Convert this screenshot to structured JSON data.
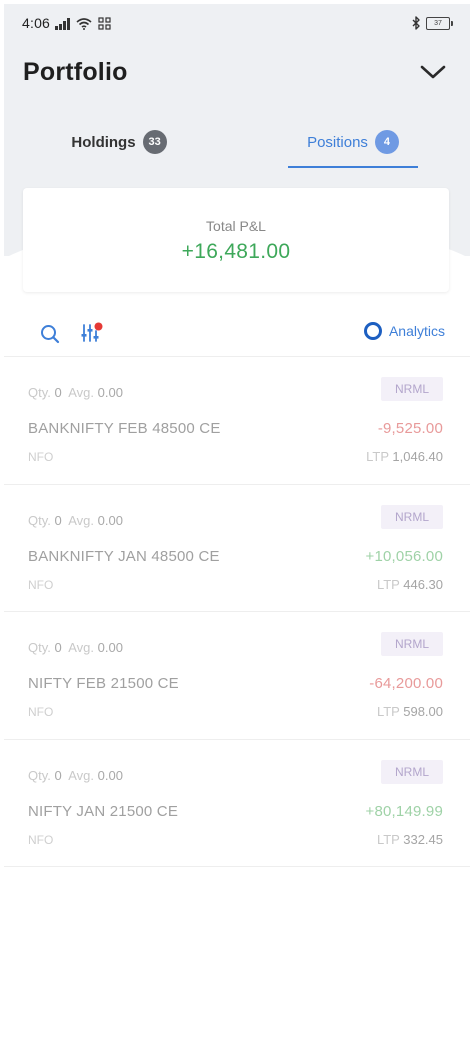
{
  "status_bar": {
    "time": "4:06",
    "battery": "37"
  },
  "header": {
    "title": "Portfolio"
  },
  "tabs": [
    {
      "label": "Holdings",
      "count": "33",
      "active": false
    },
    {
      "label": "Positions",
      "count": "4",
      "active": true
    }
  ],
  "summary": {
    "label": "Total P&L",
    "value": "+16,481.00"
  },
  "toolbar": {
    "analytics_label": "Analytics"
  },
  "colors": {
    "accent": "#3e7fd8",
    "profit": "#3ea85a",
    "loss": "#e89a9a"
  },
  "positions": [
    {
      "qty_label": "Qty.",
      "qty": "0",
      "avg_label": "Avg.",
      "avg": "0.00",
      "product": "NRML",
      "symbol": "BANKNIFTY FEB 48500 CE",
      "pnl": "-9,525.00",
      "exchange": "NFO",
      "ltp_label": "LTP",
      "ltp": "1,046.40"
    },
    {
      "qty_label": "Qty.",
      "qty": "0",
      "avg_label": "Avg.",
      "avg": "0.00",
      "product": "NRML",
      "symbol": "BANKNIFTY JAN 48500 CE",
      "pnl": "+10,056.00",
      "exchange": "NFO",
      "ltp_label": "LTP",
      "ltp": "446.30"
    },
    {
      "qty_label": "Qty.",
      "qty": "0",
      "avg_label": "Avg.",
      "avg": "0.00",
      "product": "NRML",
      "symbol": "NIFTY FEB 21500 CE",
      "pnl": "-64,200.00",
      "exchange": "NFO",
      "ltp_label": "LTP",
      "ltp": "598.00"
    },
    {
      "qty_label": "Qty.",
      "qty": "0",
      "avg_label": "Avg.",
      "avg": "0.00",
      "product": "NRML",
      "symbol": "NIFTY JAN 21500 CE",
      "pnl": "+80,149.99",
      "exchange": "NFO",
      "ltp_label": "LTP",
      "ltp": "332.45"
    }
  ]
}
